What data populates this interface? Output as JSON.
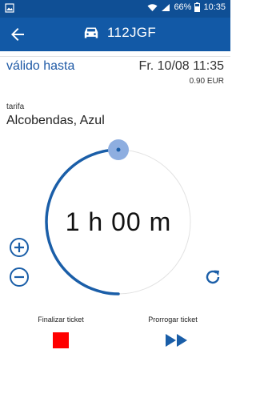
{
  "status_bar": {
    "battery": "66%",
    "time": "10:35"
  },
  "app_bar": {
    "plate": "112JGF"
  },
  "ticket": {
    "valid_label": "válido hasta",
    "valid_until": "Fr. 10/08 11:35",
    "price": "0.90 EUR"
  },
  "tariff": {
    "label": "tarifa",
    "value": "Alcobendas, Azul"
  },
  "timer": {
    "duration": "1 h 00 m",
    "progress_fraction": 0.5
  },
  "actions": {
    "finish_label": "Finalizar ticket",
    "extend_label": "Prorrogar ticket"
  },
  "colors": {
    "status_bar": "#0f4f95",
    "app_bar": "#1259a6",
    "accent": "#1f5aa6",
    "arc": "#1a5ea8",
    "stop": "#ff0000"
  }
}
